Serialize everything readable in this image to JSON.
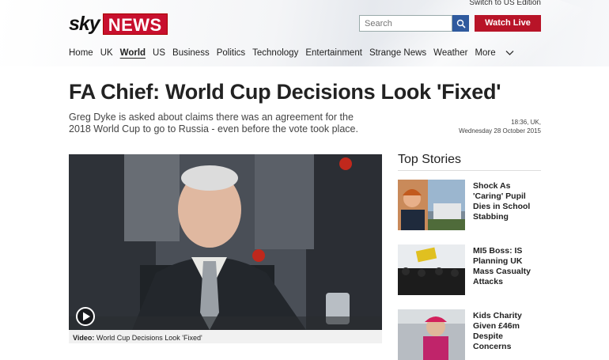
{
  "header": {
    "edition_link": "Switch to US Edition",
    "logo_sky": "sky",
    "logo_news": "NEWS",
    "search_placeholder": "Search",
    "watch_live": "Watch Live"
  },
  "nav": {
    "items": [
      "Home",
      "UK",
      "World",
      "US",
      "Business",
      "Politics",
      "Technology",
      "Entertainment",
      "Strange News",
      "Weather"
    ],
    "active": "World",
    "more_label": "More"
  },
  "article": {
    "headline": "FA Chief: World Cup Decisions Look 'Fixed'",
    "standfirst": "Greg Dyke is asked about claims there was an agreement for the 2018 World Cup to go to Russia - even before the vote took place.",
    "time": "18:36, UK,",
    "date": "Wednesday 28 October 2015",
    "video_caption_label": "Video:",
    "video_caption_text": "World Cup Decisions Look 'Fixed'"
  },
  "sidebar": {
    "heading": "Top Stories",
    "stories": [
      {
        "title": "Shock As 'Caring' Pupil Dies in School Stabbing"
      },
      {
        "title": "MI5 Boss: IS Planning UK Mass Casualty Attacks"
      },
      {
        "title": "Kids Charity Given £46m Despite Concerns"
      }
    ]
  },
  "colors": {
    "brand_red": "#c8102e",
    "search_blue": "#2f5a9e",
    "watch_red": "#b81428"
  }
}
